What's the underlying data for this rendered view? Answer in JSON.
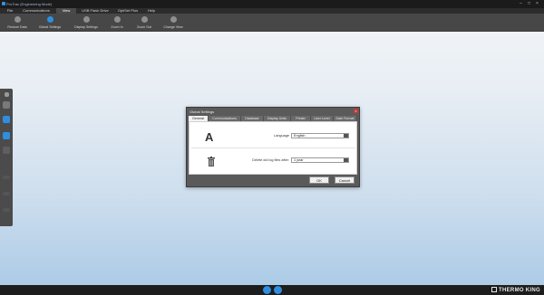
{
  "app": {
    "title": "ProTrac (Engineering Mode)"
  },
  "menu": {
    "tabs": [
      "File",
      "Communications",
      "View",
      "USB Flash Drive",
      "OptiSet Plus",
      "Help"
    ],
    "active": "View"
  },
  "ribbon": {
    "buttons": [
      "Restore Data",
      "Global Settings",
      "Display Settings",
      "Zoom In",
      "Zoom Out",
      "Change View"
    ]
  },
  "dialog": {
    "title": "Global Settings",
    "close": "×",
    "tabs": [
      "General",
      "Communications",
      "Database",
      "Display Units",
      "Printer",
      "User Level",
      "Date Format"
    ],
    "active_tab": "General",
    "language": {
      "label": "Language",
      "value": "English"
    },
    "delete_log": {
      "label": "Delete old log files after:",
      "value": "1 year"
    },
    "ok": "OK",
    "cancel": "Cancel"
  },
  "brand": {
    "logo_text": "THERMO KING"
  },
  "colors": {
    "accent": "#2e8fe0",
    "dark": "#1b1b1b",
    "ribbon": "#474747"
  }
}
